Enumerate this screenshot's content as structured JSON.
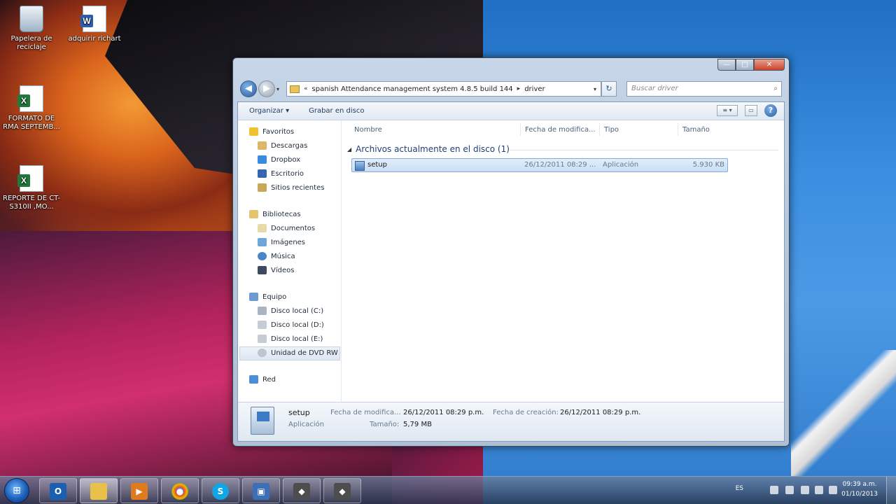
{
  "desktop_icons": [
    {
      "label": "Papelera de reciclaje"
    },
    {
      "label": "adquirir richart"
    },
    {
      "label": "FORMATO DE RMA SEPTEMB..."
    },
    {
      "label": "REPORTE DE CT-S310II ,MO..."
    }
  ],
  "window": {
    "controls": {
      "minimize": "—",
      "maximize": "□",
      "close": "✕"
    },
    "nav": {
      "back": "◀",
      "forward": "▶",
      "history": "▾"
    },
    "address": {
      "segment_1": "spanish Attendance management system 4.8.5 build 144",
      "separator_0": "«",
      "separator": "▸",
      "segment_2": "driver",
      "dropdown": "▾"
    },
    "refresh": "↻",
    "search": {
      "placeholder": "Buscar driver",
      "icon": "⌕"
    },
    "toolbar": {
      "organize": "Organizar ▾",
      "burn": "Grabar en disco",
      "view_icon": "≡ ▾",
      "preview_icon": "▭",
      "help": "?"
    },
    "nav_pane": {
      "favorites": {
        "label": "Favoritos",
        "items": [
          "Descargas",
          "Dropbox",
          "Escritorio",
          "Sitios recientes"
        ]
      },
      "libraries": {
        "label": "Bibliotecas",
        "items": [
          "Documentos",
          "Imágenes",
          "Música",
          "Vídeos"
        ]
      },
      "computer": {
        "label": "Equipo",
        "items": [
          "Disco local (C:)",
          "Disco local (D:)",
          "Disco local (E:)",
          "Unidad de DVD RW ("
        ]
      },
      "network": {
        "label": "Red"
      }
    },
    "columns": {
      "name": "Nombre",
      "modified": "Fecha de modifica...",
      "type": "Tipo",
      "size": "Tamaño"
    },
    "group": {
      "arrow": "◢",
      "title": "Archivos actualmente en el disco (1)"
    },
    "files": [
      {
        "name": "setup",
        "modified": "26/12/2011 08:29 ...",
        "type": "Aplicación",
        "size": "5.930 KB"
      }
    ],
    "details": {
      "name": "setup",
      "type": "Aplicación",
      "modified_label": "Fecha de modifica...",
      "modified_value": "26/12/2011 08:29 p.m.",
      "created_label": "Fecha de creación:",
      "created_value": "26/12/2011 08:29 p.m.",
      "size_label": "Tamaño:",
      "size_value": "5,79 MB"
    }
  },
  "taskbar": {
    "start": "⊞",
    "apps": [
      {
        "glyph": "O",
        "color": "#1b5fb0"
      },
      {
        "glyph": "",
        "color": "#e8c04a"
      },
      {
        "glyph": "▶",
        "color": "#e07a1e"
      },
      {
        "glyph": "●",
        "color": "#2f9c3f"
      },
      {
        "glyph": "S",
        "color": "#12a5e4"
      },
      {
        "glyph": "▣",
        "color": "#3b6fb6"
      },
      {
        "glyph": "◆",
        "color": "#4d4d4d"
      },
      {
        "glyph": "◆",
        "color": "#4d4d4d"
      }
    ],
    "language": "ES",
    "time": "09:39 a.m.",
    "date": "01/10/2013"
  }
}
